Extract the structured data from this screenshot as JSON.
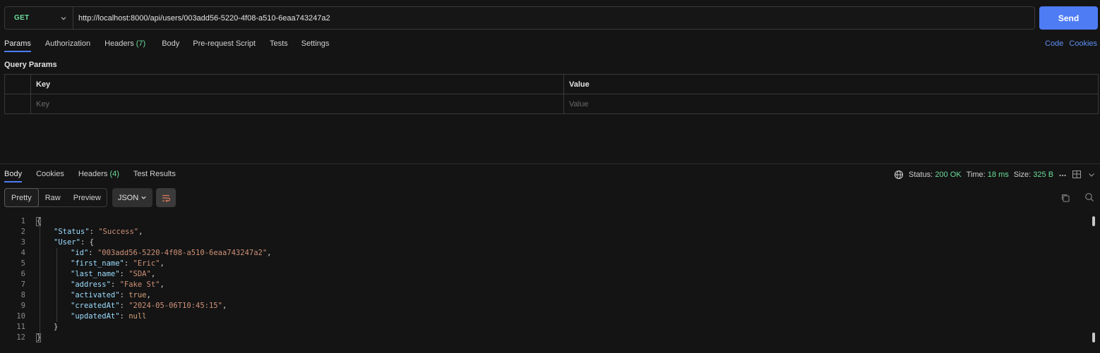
{
  "request": {
    "method": "GET",
    "url": "http://localhost:8000/api/users/003add56-5220-4f08-a510-6eaa743247a2",
    "send_label": "Send"
  },
  "request_tabs": [
    {
      "label": "Params",
      "active": true
    },
    {
      "label": "Authorization"
    },
    {
      "label": "Headers",
      "count": "(7)"
    },
    {
      "label": "Body"
    },
    {
      "label": "Pre-request Script"
    },
    {
      "label": "Tests"
    },
    {
      "label": "Settings"
    }
  ],
  "right_links": {
    "code": "Code",
    "cookies": "Cookies"
  },
  "query_params": {
    "title": "Query Params",
    "key_header": "Key",
    "value_header": "Value",
    "key_placeholder": "Key",
    "value_placeholder": "Value"
  },
  "response_tabs": [
    {
      "label": "Body",
      "active": true
    },
    {
      "label": "Cookies"
    },
    {
      "label": "Headers",
      "count": "(4)"
    },
    {
      "label": "Test Results"
    }
  ],
  "response_status": {
    "status_label": "Status:",
    "status_value": "200 OK",
    "time_label": "Time:",
    "time_value": "18 ms",
    "size_label": "Size:",
    "size_value": "325 B"
  },
  "view_modes": [
    "Pretty",
    "Raw",
    "Preview"
  ],
  "format": "JSON",
  "code_lines": [
    {
      "n": "1",
      "indent": 0,
      "parts": [
        [
          "p",
          "{"
        ]
      ]
    },
    {
      "n": "2",
      "indent": 1,
      "parts": [
        [
          "k",
          "\"Status\""
        ],
        [
          "p",
          ": "
        ],
        [
          "s",
          "\"Success\""
        ],
        [
          "p",
          ","
        ]
      ]
    },
    {
      "n": "3",
      "indent": 1,
      "parts": [
        [
          "k",
          "\"User\""
        ],
        [
          "p",
          ": {"
        ]
      ]
    },
    {
      "n": "4",
      "indent": 2,
      "parts": [
        [
          "k",
          "\"id\""
        ],
        [
          "p",
          ": "
        ],
        [
          "s",
          "\"003add56-5220-4f08-a510-6eaa743247a2\""
        ],
        [
          "p",
          ","
        ]
      ]
    },
    {
      "n": "5",
      "indent": 2,
      "parts": [
        [
          "k",
          "\"first_name\""
        ],
        [
          "p",
          ": "
        ],
        [
          "s",
          "\"Eric\""
        ],
        [
          "p",
          ","
        ]
      ]
    },
    {
      "n": "6",
      "indent": 2,
      "parts": [
        [
          "k",
          "\"last_name\""
        ],
        [
          "p",
          ": "
        ],
        [
          "s",
          "\"SDA\""
        ],
        [
          "p",
          ","
        ]
      ]
    },
    {
      "n": "7",
      "indent": 2,
      "parts": [
        [
          "k",
          "\"address\""
        ],
        [
          "p",
          ": "
        ],
        [
          "s",
          "\"Fake St\""
        ],
        [
          "p",
          ","
        ]
      ]
    },
    {
      "n": "8",
      "indent": 2,
      "parts": [
        [
          "k",
          "\"activated\""
        ],
        [
          "p",
          ": "
        ],
        [
          "kw",
          "true"
        ],
        [
          "p",
          ","
        ]
      ]
    },
    {
      "n": "9",
      "indent": 2,
      "parts": [
        [
          "k",
          "\"createdAt\""
        ],
        [
          "p",
          ": "
        ],
        [
          "s",
          "\"2024-05-06T10:45:15\""
        ],
        [
          "p",
          ","
        ]
      ]
    },
    {
      "n": "10",
      "indent": 2,
      "parts": [
        [
          "k",
          "\"updatedAt\""
        ],
        [
          "p",
          ": "
        ],
        [
          "kw",
          "null"
        ]
      ]
    },
    {
      "n": "11",
      "indent": 1,
      "parts": [
        [
          "p",
          "}"
        ]
      ]
    },
    {
      "n": "12",
      "indent": 0,
      "parts": [
        [
          "p",
          "}"
        ]
      ]
    }
  ],
  "colors": {
    "accent": "#4e7cf5",
    "method_get": "#6bdd9a",
    "status_ok": "#6bdd9a"
  }
}
